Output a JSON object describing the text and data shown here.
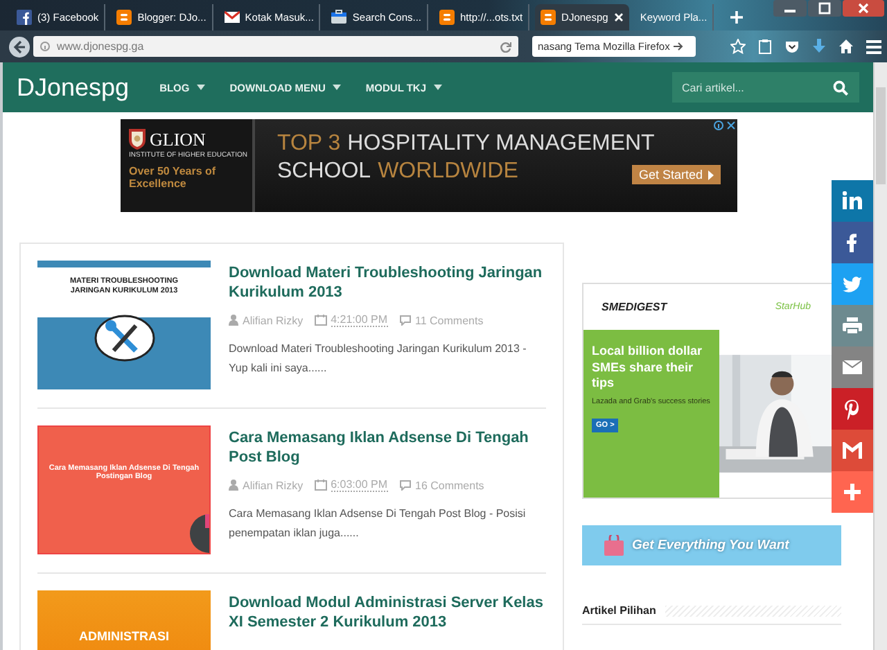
{
  "browser": {
    "tabs": [
      {
        "label": "(3) Facebook",
        "kind": "facebook",
        "selected": false
      },
      {
        "label": "Blogger: DJo...",
        "kind": "blogger",
        "selected": false
      },
      {
        "label": "Kotak Masuk...",
        "kind": "mail",
        "selected": false
      },
      {
        "label": "Search Cons...",
        "kind": "console",
        "selected": false
      },
      {
        "label": "http://...ots.txt",
        "kind": "blogger",
        "selected": false
      },
      {
        "label": "DJonespg",
        "kind": "blogger",
        "selected": true
      },
      {
        "label": "Keyword Pla...",
        "kind": "plain",
        "selected": false
      }
    ],
    "address": "www.djonespg.ga",
    "search_value": "nasang Tema Mozilla Firefox"
  },
  "site": {
    "logo": "DJonespg",
    "menu": [
      {
        "label": "BLOG"
      },
      {
        "label": "DOWNLOAD MENU"
      },
      {
        "label": "MODUL TKJ"
      }
    ],
    "search_placeholder": "Cari artikel..."
  },
  "top_ad": {
    "brand": "GLION",
    "brand_sub": "INSTITUTE OF HIGHER EDUCATION",
    "tagline": "Over 50 Years of Excellence",
    "headline": [
      [
        {
          "text": "TOP 3",
          "accent": true
        },
        {
          "text": "HOSPITALITY MANAGEMENT",
          "accent": false
        }
      ],
      [
        {
          "text": "SCHOOL",
          "accent": false
        },
        {
          "text": "WORLDWIDE",
          "accent": true
        }
      ]
    ],
    "cta": "Get Started"
  },
  "posts": [
    {
      "title": "Download Materi Troubleshooting Jaringan Kurikulum 2013",
      "kind": "tools",
      "thumb_text": "MATERI TROUBLESHOOTING JARINGAN KURIKULUM 2013",
      "author": "Alifian Rizky",
      "time": "4:21:00 PM",
      "comments": "11 Comments",
      "excerpt": "Download Materi Troubleshooting Jaringan Kurikulum 2013 - Yup kali ini saya......"
    },
    {
      "title": "Cara Memasang Iklan Adsense Di Tengah Post Blog",
      "kind": "adsense",
      "thumb_text": "Cara Memasang Iklan Adsense Di Tengah Postingan Blog",
      "author": "Alifian Rizky",
      "time": "6:03:00 PM",
      "comments": "16 Comments",
      "excerpt": "Cara Memasang Iklan Adsense Di Tengah Post Blog - Posisi penempatan iklan juga......"
    },
    {
      "title": "Download Modul Administrasi Server Kelas XI Semester 2 Kurikulum 2013",
      "kind": "admin",
      "thumb_text": "ADMINISTRASI"
    }
  ],
  "sidebar": {
    "ad": {
      "brand": "SMEDIGEST",
      "partner": "StarHub",
      "headline": "Local billion dollar SMEs share their tips",
      "sub": "Lazada and Grab's success stories",
      "cta": "GO >"
    },
    "banner": "Get Everything You Want",
    "section_title": "Artikel Pilihan"
  },
  "share": [
    {
      "kind": "linkedin",
      "color": "#0e76a8"
    },
    {
      "kind": "facebook",
      "color": "#3b5998"
    },
    {
      "kind": "twitter",
      "color": "#1da1f2"
    },
    {
      "kind": "print",
      "color": "#6d8a8f"
    },
    {
      "kind": "email",
      "color": "#848484"
    },
    {
      "kind": "pinterest",
      "color": "#cb2027"
    },
    {
      "kind": "gmail",
      "color": "#dd4b39"
    },
    {
      "kind": "plus",
      "color": "#ff6550"
    }
  ]
}
